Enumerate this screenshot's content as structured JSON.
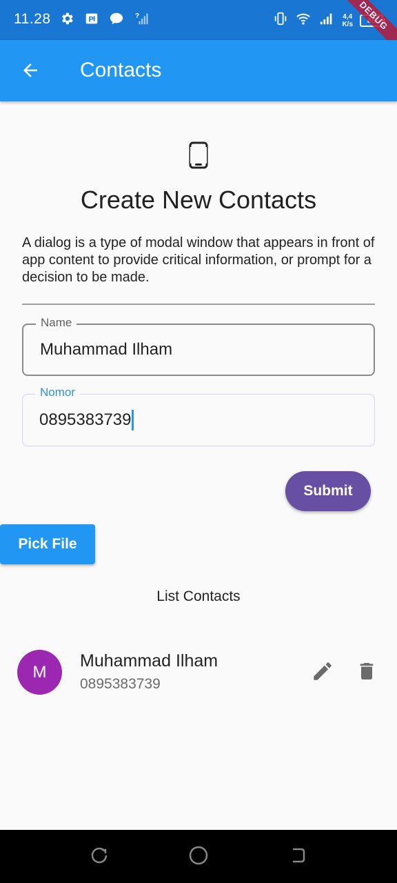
{
  "status_bar": {
    "time": "11.28",
    "netspeed_value": "4,4",
    "netspeed_unit": "K/s",
    "battery": "88",
    "debug_label": "DEBUG",
    "icons": [
      "gear-icon",
      "p-badge-icon",
      "chat-bubble-icon",
      "no-signal-icon",
      "vibrate-icon",
      "wifi-icon",
      "signal-icon",
      "battery-icon"
    ]
  },
  "app_bar": {
    "title": "Contacts",
    "back_icon": "arrow-back-icon"
  },
  "form": {
    "header_icon": "smartphone-icon",
    "title": "Create New Contacts",
    "description": "A dialog is a type of modal window that appears in front of app content to provide critical information, or prompt for a decision to be made.",
    "name_label": "Name",
    "name_value": "Muhammad Ilham",
    "nomor_label": "Nomor",
    "nomor_value": "0895383739",
    "submit_label": "Submit",
    "pick_file_label": "Pick File"
  },
  "list": {
    "title": "List Contacts",
    "contacts": [
      {
        "initial": "M",
        "name": "Muhammad Ilham",
        "phone": "0895383739"
      }
    ]
  },
  "colors": {
    "status_bar": "#1976d2",
    "app_bar": "#2196f3",
    "submit_button": "#6750a4",
    "pick_button": "#2196f3",
    "avatar": "#9c27b0",
    "focused_label": "#2a96d4"
  }
}
